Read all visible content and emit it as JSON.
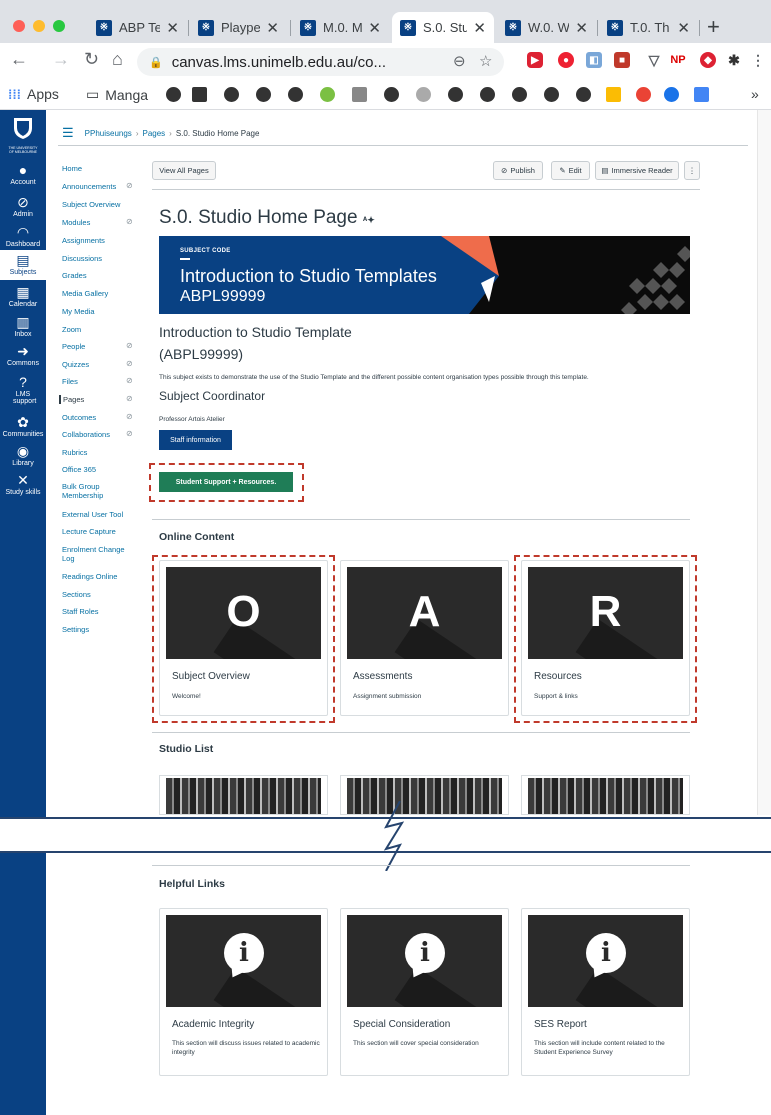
{
  "browser": {
    "tabs": [
      {
        "title": "ABP Te",
        "active": false
      },
      {
        "title": "Plaype",
        "active": false
      },
      {
        "title": "M.0. M",
        "active": false
      },
      {
        "title": "S.0. Stu",
        "active": true
      },
      {
        "title": "W.0. W",
        "active": false
      },
      {
        "title": "T.0. Th",
        "active": false
      }
    ],
    "new_tab": "+",
    "url": "canvas.lms.unimelb.edu.au/co...",
    "bookmarks": {
      "apps": "Apps",
      "manga": "Manga",
      "more": "»"
    },
    "accent": "#094183"
  },
  "global_nav": {
    "logo": "THE UNIVERSITY OF MELBOURNE",
    "items": [
      {
        "icon": "account-icon",
        "label": "Account"
      },
      {
        "icon": "admin-icon",
        "label": "Admin"
      },
      {
        "icon": "dashboard-icon",
        "label": "Dashboard"
      },
      {
        "icon": "subjects-icon",
        "label": "Subjects"
      },
      {
        "icon": "calendar-icon",
        "label": "Calendar"
      },
      {
        "icon": "inbox-icon",
        "label": "Inbox"
      },
      {
        "icon": "commons-icon",
        "label": "Commons"
      },
      {
        "icon": "lms-support-icon",
        "label": "LMS support"
      },
      {
        "icon": "communities-icon",
        "label": "Communities"
      },
      {
        "icon": "library-icon",
        "label": "Library"
      },
      {
        "icon": "study-skills-icon",
        "label": "Study skills"
      }
    ]
  },
  "breadcrumb": {
    "course": "PPhuiseungs",
    "pages": "Pages",
    "current": "S.0. Studio Home Page"
  },
  "course_nav": [
    {
      "label": "Home"
    },
    {
      "label": "Announcements"
    },
    {
      "label": "Subject Overview"
    },
    {
      "label": "Modules"
    },
    {
      "label": "Assignments"
    },
    {
      "label": "Discussions"
    },
    {
      "label": "Grades"
    },
    {
      "label": "Media Gallery"
    },
    {
      "label": "My Media"
    },
    {
      "label": "Zoom"
    },
    {
      "label": "People"
    },
    {
      "label": "Quizzes"
    },
    {
      "label": "Files"
    },
    {
      "label": "Pages"
    },
    {
      "label": "Outcomes"
    },
    {
      "label": "Collaborations"
    },
    {
      "label": "Rubrics"
    },
    {
      "label": "Office 365"
    },
    {
      "label": "Bulk Group Membership"
    },
    {
      "label": "External User Tool"
    },
    {
      "label": "Lecture Capture"
    },
    {
      "label": "Enrolment Change Log"
    },
    {
      "label": "Readings Online"
    },
    {
      "label": "Sections"
    },
    {
      "label": "Staff Roles"
    },
    {
      "label": "Settings"
    }
  ],
  "toolbar": {
    "view_all": "View All Pages",
    "publish": "Publish",
    "edit": "Edit",
    "immersive": "Immersive Reader",
    "more": "⋮"
  },
  "page": {
    "title": "S.0. Studio Home Page",
    "banner": {
      "code_label": "SUBJECT CODE",
      "title": "Introduction to Studio Templates",
      "code": "ABPL99999"
    },
    "heading": "Introduction to Studio Template",
    "heading2": "(ABPL99999)",
    "description": "This subject exists to demonstrate the use of the Studio Template and the different possible content organisation types possible through this template.",
    "coordinator_heading": "Subject Coordinator",
    "coordinator_name": "Professor Artois Atelier",
    "staff_button": "Staff information",
    "support_button": "Student Support + Resources."
  },
  "online_content": {
    "heading": "Online Content",
    "cards": [
      {
        "letter": "O",
        "title": "Subject Overview",
        "desc": "Welcome!"
      },
      {
        "letter": "A",
        "title": "Assessments",
        "desc": "Assignment submission"
      },
      {
        "letter": "R",
        "title": "Resources",
        "desc": "Support & links"
      }
    ]
  },
  "studio_list": {
    "heading": "Studio List"
  },
  "helpful_links": {
    "heading": "Helpful Links",
    "cards": [
      {
        "title": "Academic Integrity",
        "desc": "This section will discuss issues related to academic integrity"
      },
      {
        "title": "Special Consideration",
        "desc": "This section will cover special consideration"
      },
      {
        "title": "SES Report",
        "desc": "This section will include content related to the Student Experience Survey"
      }
    ]
  }
}
